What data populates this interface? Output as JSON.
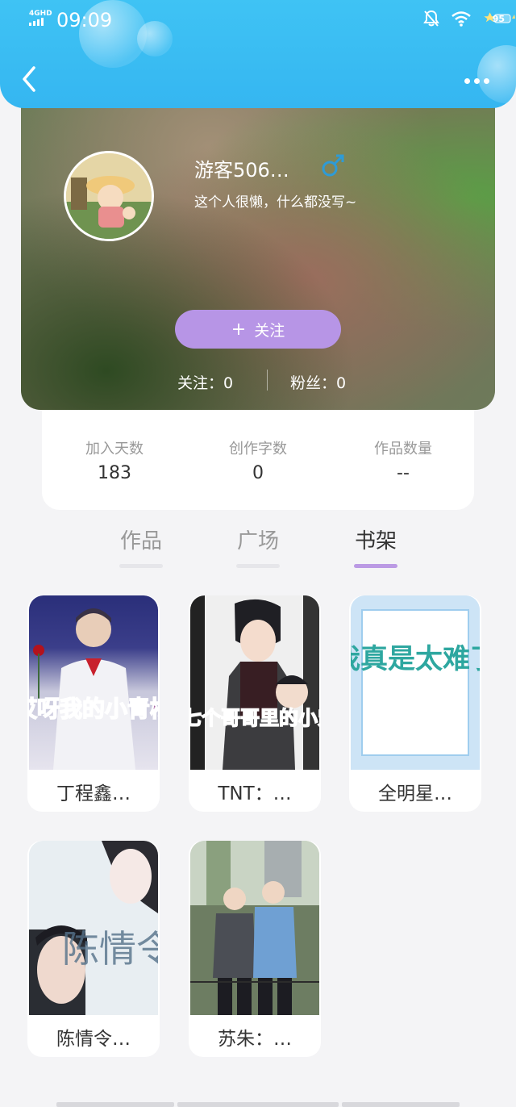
{
  "status_bar": {
    "network": "4GHD",
    "time": "09:09",
    "battery": "95"
  },
  "header": {
    "back_icon": "chevron-left-icon",
    "more_icon": "more-dots-icon"
  },
  "profile": {
    "username": "游客506…",
    "gender_icon": "male-icon",
    "bio": "这个人很懒，什么都没写~",
    "follow_button": "关注",
    "following_label": "关注：0",
    "fans_label": "粉丝：0"
  },
  "stats": [
    {
      "label": "加入天数",
      "value": "183"
    },
    {
      "label": "创作字数",
      "value": "0"
    },
    {
      "label": "作品数量",
      "value": "--"
    }
  ],
  "tabs": [
    {
      "label": "作品",
      "active": false
    },
    {
      "label": "广场",
      "active": false
    },
    {
      "label": "书架",
      "active": true
    }
  ],
  "books": [
    {
      "title": "丁程鑫…",
      "cover_text": "哎呀我的小青梅"
    },
    {
      "title": "TNT：…",
      "cover_text": "穿越成七个哥哥里的小宠"
    },
    {
      "title": "全明星…",
      "cover_text": "我真是太难了"
    },
    {
      "title": "陈情令…",
      "cover_text": "陈情令"
    },
    {
      "title": "苏朱：…",
      "cover_text": ""
    }
  ],
  "colors": {
    "header_blue": "#3fc3f4",
    "follow_purple": "#b795e6",
    "tab_active_underline": "#bb9ae4",
    "male_blue": "#2e9bd6"
  }
}
